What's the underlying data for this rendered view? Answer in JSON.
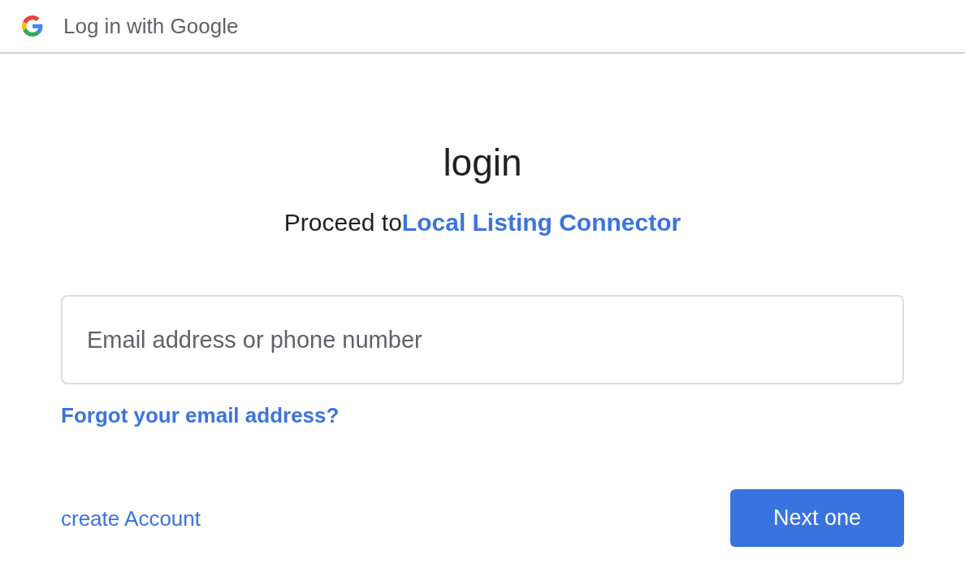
{
  "header": {
    "title": "Log in with Google"
  },
  "heading": "login",
  "subtitle": {
    "text": "Proceed to",
    "link": "Local Listing Connector"
  },
  "email_field": {
    "placeholder": "Email address or phone number"
  },
  "forgot_link": "Forgot your email address?",
  "create_account_link": "create Account",
  "next_button": "Next one"
}
